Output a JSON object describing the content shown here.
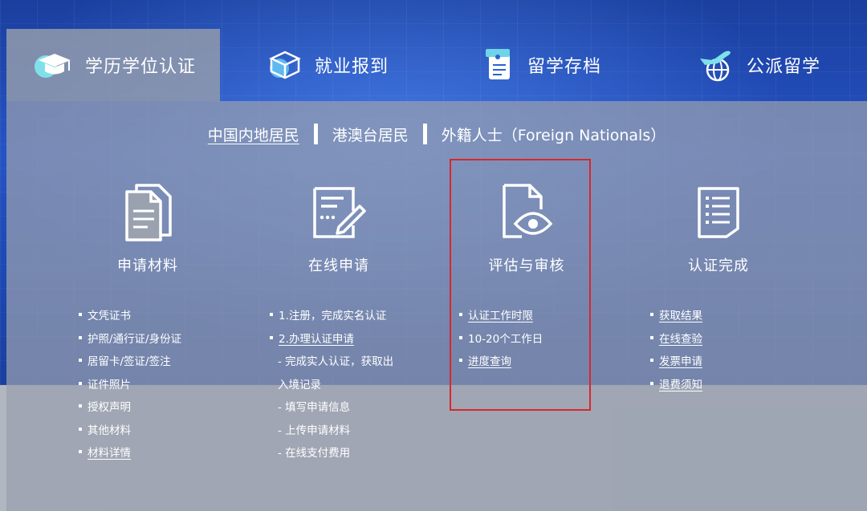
{
  "tabs": [
    {
      "label": "学历学位认证",
      "icon": "graduation-cap-icon",
      "active": true
    },
    {
      "label": "就业报到",
      "icon": "cube-icon",
      "active": false
    },
    {
      "label": "留学存档",
      "icon": "document-archive-icon",
      "active": false
    },
    {
      "label": "公派留学",
      "icon": "plane-globe-icon",
      "active": false
    }
  ],
  "subnav": [
    {
      "label": "中国内地居民",
      "active": true
    },
    {
      "label": "港澳台居民",
      "active": false
    },
    {
      "label": "外籍人士（Foreign Nationals）",
      "active": false
    }
  ],
  "steps": [
    {
      "title": "申请材料",
      "icon": "documents-icon",
      "items": [
        {
          "text": "文凭证书",
          "bullet": true,
          "link": false
        },
        {
          "text": "护照/通行证/身份证",
          "bullet": true,
          "link": false
        },
        {
          "text": "居留卡/签证/签注",
          "bullet": true,
          "link": false
        },
        {
          "text": "证件照片",
          "bullet": true,
          "link": false
        },
        {
          "text": "授权声明",
          "bullet": true,
          "link": false
        },
        {
          "text": "其他材料",
          "bullet": true,
          "link": false
        },
        {
          "text": "材料详情",
          "bullet": true,
          "link": true
        }
      ]
    },
    {
      "title": "在线申请",
      "icon": "form-pencil-icon",
      "items": [
        {
          "text": "1.注册，完成实名认证",
          "bullet": true,
          "link": false
        },
        {
          "text": "2.办理认证申请",
          "bullet": true,
          "link": true
        },
        {
          "text": "- 完成实人认证，获取出",
          "bullet": false,
          "link": false
        },
        {
          "text": "入境记录",
          "bullet": false,
          "link": false
        },
        {
          "text": "- 填写申请信息",
          "bullet": false,
          "link": false
        },
        {
          "text": "- 上传申请材料",
          "bullet": false,
          "link": false
        },
        {
          "text": "- 在线支付费用",
          "bullet": false,
          "link": false
        }
      ]
    },
    {
      "title": "评估与审核",
      "icon": "document-eye-icon",
      "items": [
        {
          "text": "认证工作时限",
          "bullet": true,
          "link": true
        },
        {
          "text": "10-20个工作日",
          "bullet": true,
          "link": false
        },
        {
          "text": "进度查询",
          "bullet": true,
          "link": true
        }
      ]
    },
    {
      "title": "认证完成",
      "icon": "checklist-icon",
      "items": [
        {
          "text": "获取结果",
          "bullet": true,
          "link": true
        },
        {
          "text": "在线查验",
          "bullet": true,
          "link": true
        },
        {
          "text": "发票申请",
          "bullet": true,
          "link": true
        },
        {
          "text": "退费须知",
          "bullet": true,
          "link": true
        }
      ]
    }
  ],
  "colors": {
    "highlight_border": "#d9262b",
    "active_tab_bg": "#969eac",
    "text": "#ffffff"
  }
}
